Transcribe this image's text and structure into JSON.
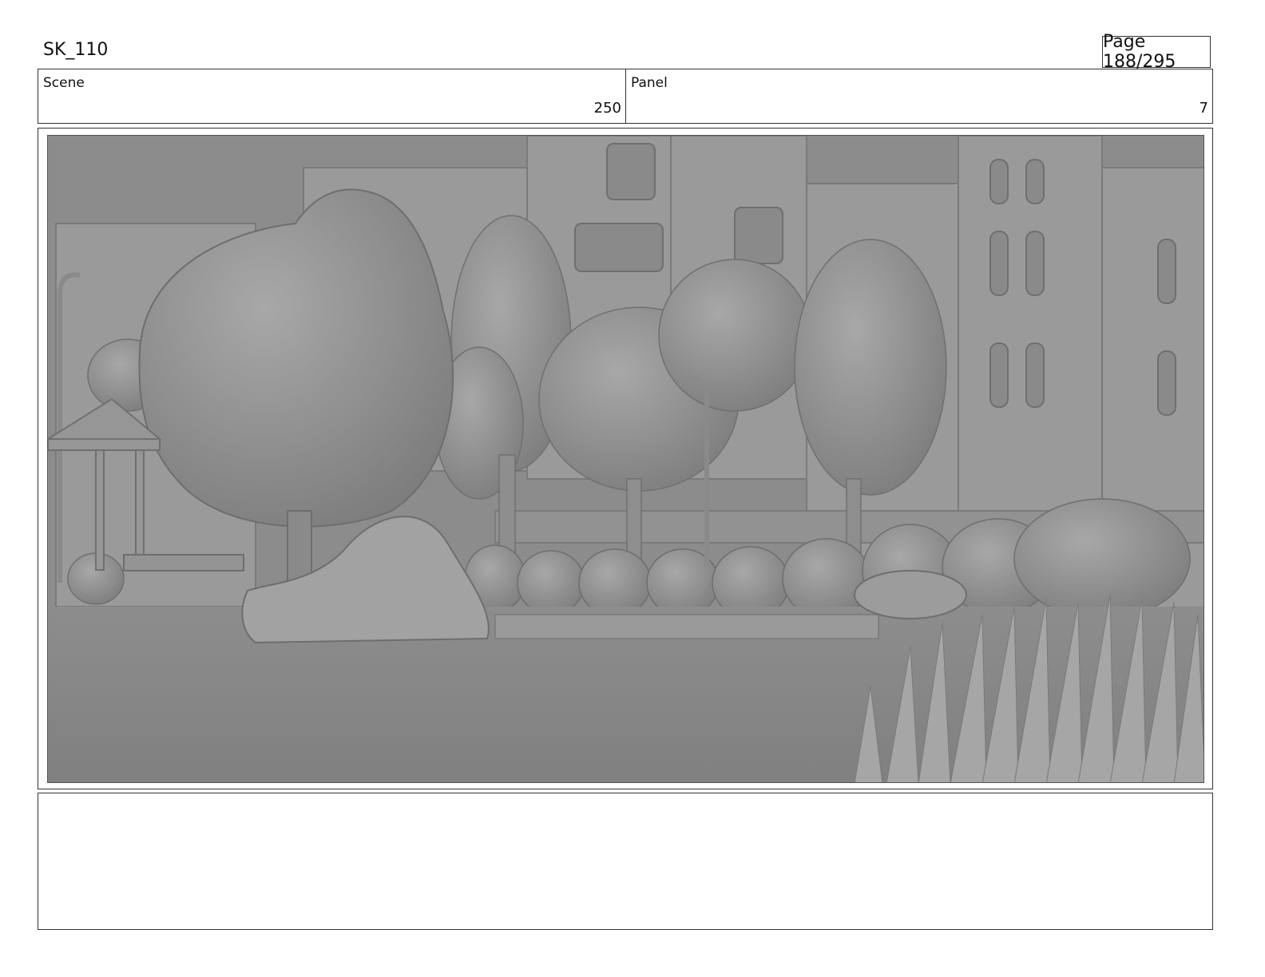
{
  "header": {
    "project_code": "SK_110",
    "page_label": "Page 188/295"
  },
  "info": {
    "scene_label": "Scene",
    "scene_value": "250",
    "panel_label": "Panel",
    "panel_value": "7"
  },
  "frame": {
    "image_description_icon": "grey-render-park-scene"
  },
  "notes": {
    "text": ""
  }
}
